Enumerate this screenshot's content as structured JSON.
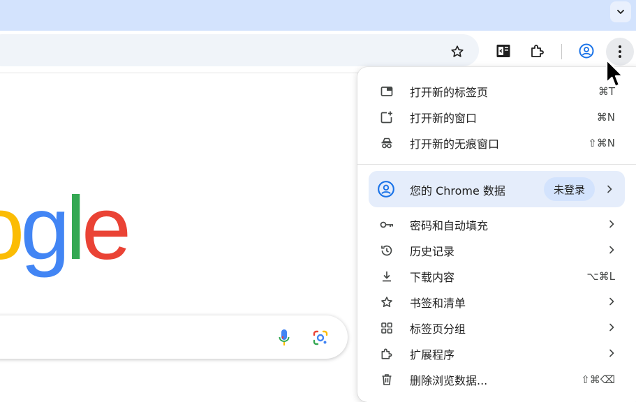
{
  "toolbar": {
    "icons": [
      "tab-search-icon",
      "bookmark-star-icon",
      "reading-list-icon",
      "extensions-icon",
      "profile-icon",
      "more-menu-icon"
    ]
  },
  "page": {
    "logo_text": [
      "o",
      "g",
      "l",
      "e"
    ],
    "logo_colors": [
      "#fbbc04",
      "#4285f4",
      "#34a853",
      "#ea4335"
    ]
  },
  "menu": {
    "items_top": [
      {
        "label": "打开新的标签页",
        "shortcut": "⌘T",
        "icon": "new-tab-icon"
      },
      {
        "label": "打开新的窗口",
        "shortcut": "⌘N",
        "icon": "new-window-icon"
      },
      {
        "label": "打开新的无痕窗口",
        "shortcut": "⇧⌘N",
        "icon": "incognito-icon"
      }
    ],
    "profile": {
      "label": "您的 Chrome 数据",
      "badge": "未登录",
      "icon": "profile-icon"
    },
    "items_bottom": [
      {
        "label": "密码和自动填充",
        "shortcut": "",
        "icon": "key-icon"
      },
      {
        "label": "历史记录",
        "shortcut": "",
        "icon": "history-icon"
      },
      {
        "label": "下载内容",
        "shortcut": "⌥⌘L",
        "icon": "download-icon"
      },
      {
        "label": "书签和清单",
        "shortcut": "",
        "icon": "star-icon"
      },
      {
        "label": "标签页分组",
        "shortcut": "",
        "icon": "tab-groups-icon"
      },
      {
        "label": "扩展程序",
        "shortcut": "",
        "icon": "extensions-icon"
      },
      {
        "label": "删除浏览数据...",
        "shortcut": "⇧⌘⌫",
        "icon": "trash-icon"
      }
    ]
  },
  "colors": {
    "accent": "#1a73e8",
    "tab_strip": "#d3e3fd",
    "menu_highlight": "#e5edfb"
  }
}
